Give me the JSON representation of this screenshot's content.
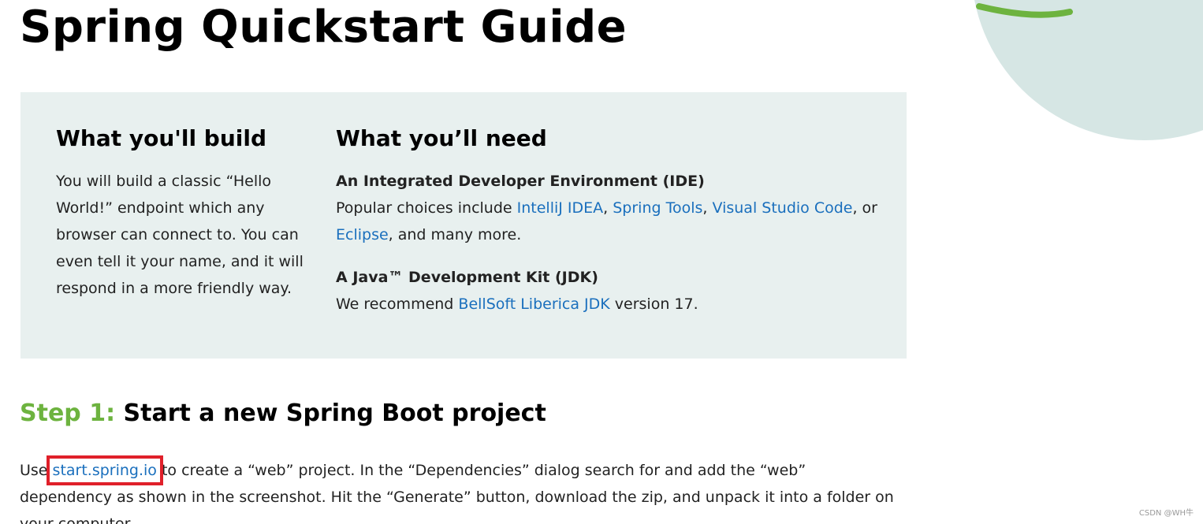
{
  "page": {
    "title": "Spring Quickstart Guide"
  },
  "build": {
    "heading": "What you'll build",
    "description": "You will build a classic “Hello World!” endpoint which any browser can connect to. You can even tell it your name, and it will respond in a more friendly way."
  },
  "need": {
    "heading": "What you’ll need",
    "ide": {
      "title": "An Integrated Developer Environment (IDE)",
      "prefix": "Popular choices include ",
      "links": [
        "IntelliJ IDEA",
        "Spring Tools",
        "Visual Studio Code",
        "Eclipse"
      ],
      "sep1": ", ",
      "sep2": ", ",
      "sep3": ", or ",
      "suffix": ", and many more."
    },
    "jdk": {
      "title": "A Java™ Development Kit (JDK)",
      "prefix": "We recommend ",
      "link": "BellSoft Liberica JDK",
      "suffix": " version 17."
    }
  },
  "step1": {
    "number": "Step 1:",
    "title": " Start a new Spring Boot project",
    "text_prefix": "Use ",
    "link": "start.spring.io",
    "text_suffix": " to create a “web” project. In the “Dependencies” dialog search for and add the “web” dependency as shown in the screenshot. Hit the “Generate” button, download the zip, and unpack it into a folder on your computer."
  },
  "watermark": "CSDN @WH牛",
  "colors": {
    "accent_green": "#6db33f",
    "link_blue": "#1a6fbd",
    "box_bg": "#e8f0ef",
    "highlight_red": "#e0202a",
    "deco_circle": "#d6e6e4"
  }
}
